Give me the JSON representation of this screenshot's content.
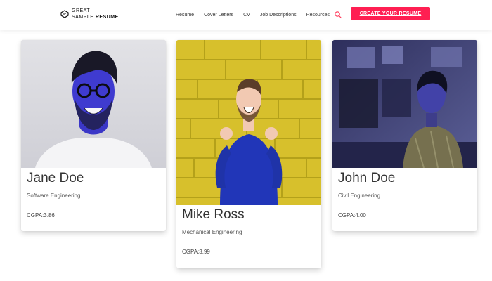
{
  "header": {
    "logo": {
      "line1": "GREAT",
      "line2_prefix": "SAMPLE",
      "line2_bold": "RESUME",
      "icon": "resume-logo-icon"
    },
    "nav": [
      {
        "label": "Resume"
      },
      {
        "label": "Cover Letters"
      },
      {
        "label": "CV"
      },
      {
        "label": "Job Descriptions"
      },
      {
        "label": "Resources"
      }
    ],
    "search_icon": "search-icon",
    "cta_label": "CREATE YOUR RESUME",
    "cta_color": "#ff1f52"
  },
  "students": [
    {
      "name": "Jane Doe",
      "major": "Software Engineering",
      "cgpa": "CGPA:3.86",
      "photo": "portrait-photo"
    },
    {
      "name": "Mike Ross",
      "major": "Mechanical Engineering",
      "cgpa": "CGPA:3.99",
      "photo": "portrait-photo"
    },
    {
      "name": "John Doe",
      "major": "Civil Engineering",
      "cgpa": "CGPA:4.00",
      "photo": "portrait-photo"
    }
  ]
}
